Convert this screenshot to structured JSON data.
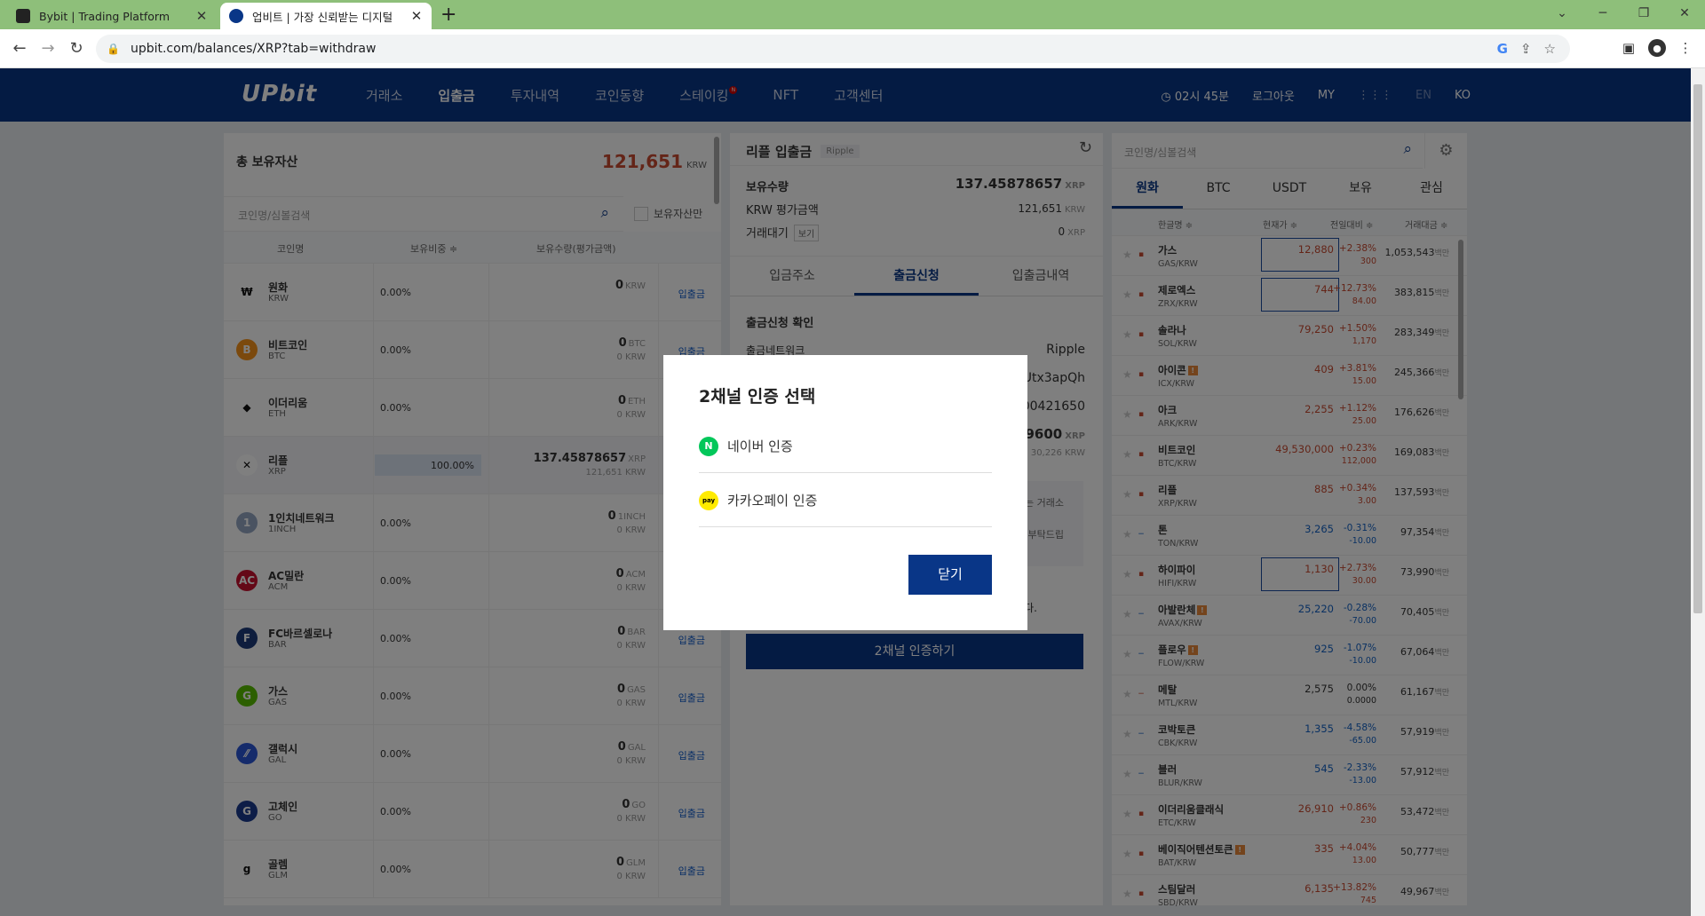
{
  "browser": {
    "tabs": [
      {
        "title": "Bybit | Trading Platform",
        "favicon": "BYBIT"
      },
      {
        "title": "업비트 | 가장 신뢰받는 디지털",
        "favicon": "UP"
      }
    ],
    "url": "upbit.com/balances/XRP?tab=withdraw"
  },
  "header": {
    "logo": "UPbit",
    "nav": [
      "거래소",
      "입출금",
      "투자내역",
      "코인동향",
      "스테이킹",
      "NFT",
      "고객센터"
    ],
    "nav_new_badge": "N",
    "timer": "02시 45분",
    "logout": "로그아웃",
    "my": "MY",
    "lang_en": "EN",
    "lang_ko": "KO"
  },
  "assets": {
    "title": "총 보유자산",
    "total": "121,651",
    "total_unit": "KRW",
    "search_placeholder": "코인명/심볼검색",
    "own_only": "보유자산만",
    "col_name": "코인명",
    "col_ratio": "보유비중 ≑",
    "col_amount": "보유수량(평가금액)",
    "rows": [
      {
        "name": "원화",
        "sym": "KRW",
        "pct": "0.00%",
        "amt": "0",
        "unit": "KRW",
        "sub": "",
        "btn": "입출금",
        "icon_color": "#ffffff",
        "icon_text": "₩"
      },
      {
        "name": "비트코인",
        "sym": "BTC",
        "pct": "0.00%",
        "amt": "0",
        "unit": "BTC",
        "sub": "0 KRW",
        "btn": "입출금",
        "icon_color": "#f7931a",
        "icon_text": "B"
      },
      {
        "name": "이더리움",
        "sym": "ETH",
        "pct": "0.00%",
        "amt": "0",
        "unit": "ETH",
        "sub": "0 KRW",
        "btn": "입출금",
        "icon_color": "#ffffff",
        "icon_text": "◆"
      },
      {
        "name": "리플",
        "sym": "XRP",
        "pct": "100.00%",
        "amt": "137.45878657",
        "unit": "XRP",
        "sub": "121,651 KRW",
        "btn": "입출금",
        "icon_color": "#ffffff",
        "icon_text": "✕"
      },
      {
        "name": "1인치네트워크",
        "sym": "1INCH",
        "pct": "0.00%",
        "amt": "0",
        "unit": "1INCH",
        "sub": "0 KRW",
        "btn": "입출금",
        "icon_color": "#94a6c3",
        "icon_text": "1"
      },
      {
        "name": "AC밀란",
        "sym": "ACM",
        "pct": "0.00%",
        "amt": "0",
        "unit": "ACM",
        "sub": "0 KRW",
        "btn": "입출금",
        "icon_color": "#c8102e",
        "icon_text": "AC"
      },
      {
        "name": "FC바르셀로나",
        "sym": "BAR",
        "pct": "0.00%",
        "amt": "0",
        "unit": "BAR",
        "sub": "0 KRW",
        "btn": "입출금",
        "icon_color": "#1c3a7a",
        "icon_text": "F"
      },
      {
        "name": "가스",
        "sym": "GAS",
        "pct": "0.00%",
        "amt": "0",
        "unit": "GAS",
        "sub": "0 KRW",
        "btn": "입출금",
        "icon_color": "#58bf00",
        "icon_text": "G"
      },
      {
        "name": "갤럭시",
        "sym": "GAL",
        "pct": "0.00%",
        "amt": "0",
        "unit": "GAL",
        "sub": "0 KRW",
        "btn": "입출금",
        "icon_color": "#2a56d6",
        "icon_text": "⁄⁄"
      },
      {
        "name": "고체인",
        "sym": "GO",
        "pct": "0.00%",
        "amt": "0",
        "unit": "GO",
        "sub": "0 KRW",
        "btn": "입출금",
        "icon_color": "#1a3a8f",
        "icon_text": "G"
      },
      {
        "name": "골렘",
        "sym": "GLM",
        "pct": "0.00%",
        "amt": "0",
        "unit": "GLM",
        "sub": "0 KRW",
        "btn": "입출금",
        "icon_color": "#ffffff",
        "icon_text": "g"
      }
    ]
  },
  "deposit": {
    "title": "리플 입출금",
    "chip": "Ripple",
    "holding_label": "보유수량",
    "holding_value": "137.45878657",
    "holding_unit": "XRP",
    "krw_label": "KRW 평가금액",
    "krw_value": "121,651",
    "krw_unit": "KRW",
    "pending_label": "거래대기",
    "pending_chip": "보기",
    "pending_value": "0",
    "pending_unit": "XRP",
    "tabs": [
      "입금주소",
      "출금신청",
      "입출금내역"
    ],
    "section_title": "출금신청 확인",
    "network_label": "출금네트워크",
    "network_value": "Ripple",
    "addr_partial": "DUtx3apQh",
    "tag_partial": "500421650",
    "amount_partial": "9600",
    "amount_unit": "XRP",
    "amount_krw": "30,226 KRW",
    "notice1": "는 거래소",
    "notice2": "부탁드립",
    "notice3": "다.",
    "auth_button": "2채널 인증하기"
  },
  "market": {
    "search_placeholder": "코인명/심볼검색",
    "tabs": [
      "원화",
      "BTC",
      "USDT",
      "보유",
      "관심"
    ],
    "col_name": "한글명 ≑",
    "col_price": "현재가 ≑",
    "col_change": "전일대비 ≑",
    "col_volume": "거래대금 ≑",
    "volume_unit": "백만",
    "rows": [
      {
        "name": "가스",
        "sym": "GAS/KRW",
        "price": "12,880",
        "pct": "+2.38%",
        "diff": "300",
        "vol": "1,053,543",
        "dir": "up",
        "box": true,
        "warn": false
      },
      {
        "name": "제로엑스",
        "sym": "ZRX/KRW",
        "price": "744",
        "pct": "+12.73%",
        "diff": "84.00",
        "vol": "383,815",
        "dir": "up",
        "box": true,
        "warn": false
      },
      {
        "name": "솔라나",
        "sym": "SOL/KRW",
        "price": "79,250",
        "pct": "+1.50%",
        "diff": "1,170",
        "vol": "283,349",
        "dir": "up",
        "box": false,
        "warn": false
      },
      {
        "name": "아이콘",
        "sym": "ICX/KRW",
        "price": "409",
        "pct": "+3.81%",
        "diff": "15.00",
        "vol": "245,366",
        "dir": "up",
        "box": false,
        "warn": true
      },
      {
        "name": "아크",
        "sym": "ARK/KRW",
        "price": "2,255",
        "pct": "+1.12%",
        "diff": "25.00",
        "vol": "176,626",
        "dir": "up",
        "box": false,
        "warn": false
      },
      {
        "name": "비트코인",
        "sym": "BTC/KRW",
        "price": "49,530,000",
        "pct": "+0.23%",
        "diff": "112,000",
        "vol": "169,083",
        "dir": "up",
        "box": false,
        "warn": false
      },
      {
        "name": "리플",
        "sym": "XRP/KRW",
        "price": "885",
        "pct": "+0.34%",
        "diff": "3.00",
        "vol": "137,593",
        "dir": "up",
        "box": false,
        "warn": false
      },
      {
        "name": "톤",
        "sym": "TON/KRW",
        "price": "3,265",
        "pct": "-0.31%",
        "diff": "-10.00",
        "vol": "97,354",
        "dir": "dn",
        "box": false,
        "warn": false
      },
      {
        "name": "하이파이",
        "sym": "HIFI/KRW",
        "price": "1,130",
        "pct": "+2.73%",
        "diff": "30.00",
        "vol": "73,990",
        "dir": "up",
        "box": true,
        "warn": false
      },
      {
        "name": "아발란체",
        "sym": "AVAX/KRW",
        "price": "25,220",
        "pct": "-0.28%",
        "diff": "-70.00",
        "vol": "70,405",
        "dir": "dn",
        "box": false,
        "warn": true
      },
      {
        "name": "플로우",
        "sym": "FLOW/KRW",
        "price": "925",
        "pct": "-1.07%",
        "diff": "-10.00",
        "vol": "67,064",
        "dir": "dn",
        "box": false,
        "warn": true
      },
      {
        "name": "메탈",
        "sym": "MTL/KRW",
        "price": "2,575",
        "pct": "0.00%",
        "diff": "0.0000",
        "vol": "61,167",
        "dir": "ev",
        "box": false,
        "warn": false
      },
      {
        "name": "코박토큰",
        "sym": "CBK/KRW",
        "price": "1,355",
        "pct": "-4.58%",
        "diff": "-65.00",
        "vol": "57,919",
        "dir": "dn",
        "box": false,
        "warn": false
      },
      {
        "name": "블러",
        "sym": "BLUR/KRW",
        "price": "545",
        "pct": "-2.33%",
        "diff": "-13.00",
        "vol": "57,912",
        "dir": "dn",
        "box": false,
        "warn": false
      },
      {
        "name": "이더리움클래식",
        "sym": "ETC/KRW",
        "price": "26,910",
        "pct": "+0.86%",
        "diff": "230",
        "vol": "53,472",
        "dir": "up",
        "box": false,
        "warn": false
      },
      {
        "name": "베이직어텐션토큰",
        "sym": "BAT/KRW",
        "price": "335",
        "pct": "+4.04%",
        "diff": "13.00",
        "vol": "50,777",
        "dir": "up",
        "box": false,
        "warn": true
      },
      {
        "name": "스팀달러",
        "sym": "SBD/KRW",
        "price": "6,135",
        "pct": "+13.82%",
        "diff": "745",
        "vol": "49,967",
        "dir": "up",
        "box": false,
        "warn": false
      }
    ]
  },
  "modal": {
    "title": "2채널 인증 선택",
    "opt_naver": "네이버 인증",
    "opt_kakao": "카카오페이 인증",
    "naver_icon_text": "N",
    "kakao_icon_text": "pay",
    "close": "닫기"
  },
  "colors": {
    "brand": "#093687",
    "up": "#c84a31",
    "down": "#1261c4",
    "naver": "#03c75a",
    "kakao": "#ffeb00"
  }
}
